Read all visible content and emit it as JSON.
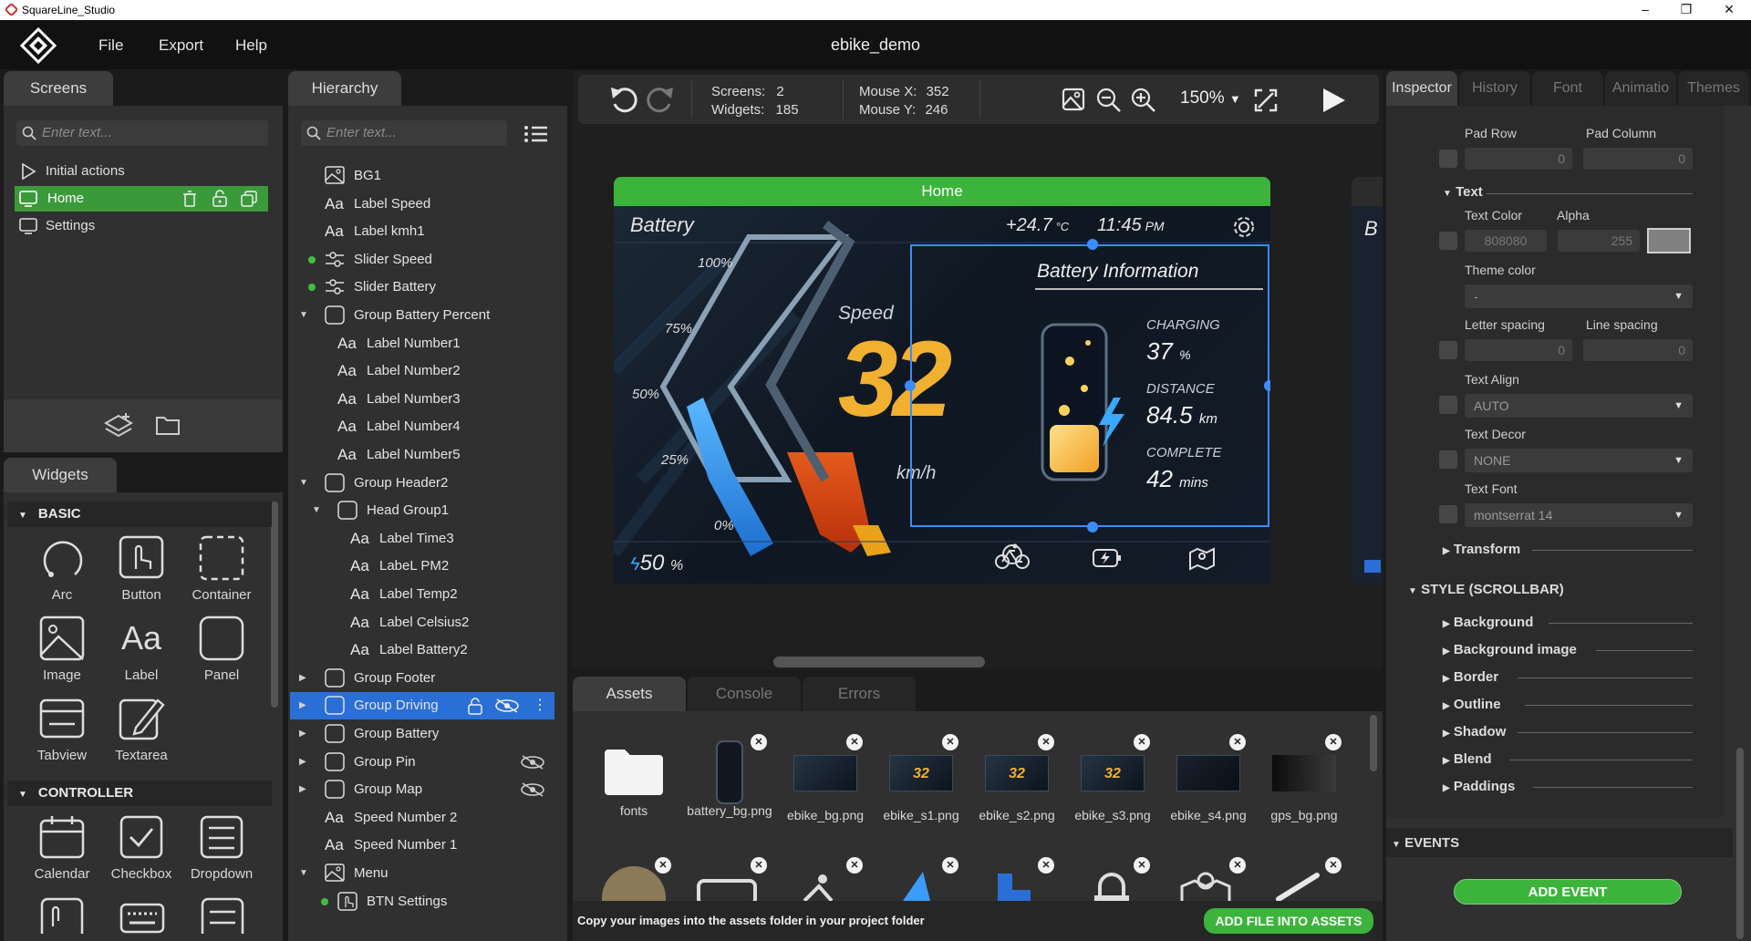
{
  "window": {
    "title": "SquareLine_Studio",
    "minimize": "–",
    "maximize": "❐",
    "close": "✕"
  },
  "menu": {
    "file": "File",
    "export": "Export",
    "help": "Help",
    "project_name": "ebike_demo"
  },
  "screens_panel": {
    "tab": "Screens",
    "search_placeholder": "Enter text...",
    "items": [
      {
        "label": "Initial actions"
      },
      {
        "label": "Home",
        "selected": true
      },
      {
        "label": "Settings"
      }
    ]
  },
  "widgets_panel": {
    "tab": "Widgets",
    "basic_section": "BASIC",
    "basic": [
      "Arc",
      "Button",
      "Container",
      "Image",
      "Label",
      "Panel",
      "Tabview",
      "Textarea"
    ],
    "controller_section": "CONTROLLER",
    "controller": [
      "Calendar",
      "Checkbox",
      "Dropdown"
    ]
  },
  "hierarchy_panel": {
    "tab": "Hierarchy",
    "search_placeholder": "Enter text...",
    "rows": [
      {
        "label": "BG1",
        "icon": "image-icon",
        "indent": 0
      },
      {
        "label": "Label Speed",
        "icon": "label-icon",
        "indent": 0
      },
      {
        "label": "Label kmh1",
        "icon": "label-icon",
        "indent": 0
      },
      {
        "label": "Slider Speed",
        "icon": "slider-icon",
        "indent": 0,
        "dot": true
      },
      {
        "label": "Slider Battery",
        "icon": "slider-icon",
        "indent": 0,
        "dot": true
      },
      {
        "label": "Group Battery Percent",
        "icon": "group-icon",
        "indent": 0,
        "expanded": true
      },
      {
        "label": "Label Number1",
        "icon": "label-icon",
        "indent": 1
      },
      {
        "label": "Label Number2",
        "icon": "label-icon",
        "indent": 1
      },
      {
        "label": "Label Number3",
        "icon": "label-icon",
        "indent": 1
      },
      {
        "label": "Label Number4",
        "icon": "label-icon",
        "indent": 1
      },
      {
        "label": "Label Number5",
        "icon": "label-icon",
        "indent": 1
      },
      {
        "label": "Group Header2",
        "icon": "group-icon",
        "indent": 0,
        "expanded": true
      },
      {
        "label": "Head Group1",
        "icon": "group-icon",
        "indent": 1,
        "expanded": true
      },
      {
        "label": "Label Time3",
        "icon": "label-icon",
        "indent": 2
      },
      {
        "label": "LabeL PM2",
        "icon": "label-icon",
        "indent": 2
      },
      {
        "label": "Label Temp2",
        "icon": "label-icon",
        "indent": 2
      },
      {
        "label": "Label Celsius2",
        "icon": "label-icon",
        "indent": 2
      },
      {
        "label": "Label Battery2",
        "icon": "label-icon",
        "indent": 2
      },
      {
        "label": "Group Footer",
        "icon": "group-icon",
        "indent": 0,
        "collapsed": true
      },
      {
        "label": "Group Driving",
        "icon": "group-icon",
        "indent": 0,
        "collapsed": true,
        "selected": true
      },
      {
        "label": "Group Battery",
        "icon": "group-icon",
        "indent": 0,
        "collapsed": true
      },
      {
        "label": "Group Pin",
        "icon": "group-icon",
        "indent": 0,
        "collapsed": true,
        "hidden": true
      },
      {
        "label": "Group Map",
        "icon": "group-icon",
        "indent": 0,
        "collapsed": true,
        "hidden": true
      },
      {
        "label": "Speed Number 2",
        "icon": "label-icon",
        "indent": 0
      },
      {
        "label": "Speed Number 1",
        "icon": "label-icon",
        "indent": 0
      },
      {
        "label": "Menu",
        "icon": "image-icon",
        "indent": 0,
        "expanded": true
      },
      {
        "label": "BTN Settings",
        "icon": "button-icon",
        "indent": 1,
        "dot": true
      }
    ]
  },
  "canvas_toolbar": {
    "screens_label": "Screens:",
    "screens_value": "2",
    "widgets_label": "Widgets:",
    "widgets_value": "185",
    "mousex_label": "Mouse X:",
    "mousex_value": "352",
    "mousey_label": "Mouse Y:",
    "mousey_value": "246",
    "zoom": "150%"
  },
  "screen_preview": {
    "screen_name": "Home",
    "battery_title": "Battery",
    "temp": "+24.7",
    "temp_unit": "°C",
    "time": "11:45",
    "ampm": "PM",
    "battery_info_title": "Battery Information",
    "speed_word": "Speed",
    "speed_value": "32",
    "speed_unit": "km/h",
    "ticks": [
      "100%",
      "75%",
      "50%",
      "25%",
      "0%"
    ],
    "charging_label": "CHARGING",
    "charging_value": "37",
    "charging_unit": "%",
    "distance_label": "DISTANCE",
    "distance_value": "84.5",
    "distance_unit": "km",
    "complete_label": "COMPLETE",
    "complete_value": "42",
    "complete_unit": "mins",
    "battery_bottom": "50",
    "battery_bottom_unit": "%",
    "next_screen_letter": "B"
  },
  "bottom_panel": {
    "tabs": [
      "Assets",
      "Console",
      "Errors"
    ],
    "assets": [
      {
        "name": "fonts"
      },
      {
        "name": "battery_bg.png"
      },
      {
        "name": "ebike_bg.png"
      },
      {
        "name": "ebike_s1.png"
      },
      {
        "name": "ebike_s2.png"
      },
      {
        "name": "ebike_s3.png"
      },
      {
        "name": "ebike_s4.png"
      },
      {
        "name": "gps_bg.png"
      }
    ],
    "hint": "Copy your images into the assets folder in your project folder",
    "add_button": "ADD FILE INTO ASSETS"
  },
  "inspector": {
    "tabs": [
      "Inspector",
      "History",
      "Font",
      "Animatio",
      "Themes"
    ],
    "pad_row_label": "Pad Row",
    "pad_row_value": "0",
    "pad_col_label": "Pad Column",
    "pad_col_value": "0",
    "text_section": "Text",
    "text_color_label": "Text Color",
    "alpha_label": "Alpha",
    "text_color_value": "808080",
    "alpha_value": "255",
    "theme_color_label": "Theme color",
    "theme_color_value": "-",
    "letter_spacing_label": "Letter spacing",
    "letter_spacing_value": "0",
    "line_spacing_label": "Line spacing",
    "line_spacing_value": "0",
    "text_align_label": "Text Align",
    "text_align_value": "AUTO",
    "text_decor_label": "Text Decor",
    "text_decor_value": "NONE",
    "text_font_label": "Text Font",
    "text_font_value": "montserrat 14",
    "transform": "Transform",
    "style_scrollbar": "STYLE (SCROLLBAR)",
    "style_props": [
      "Background",
      "Background image",
      "Border",
      "Outline",
      "Shadow",
      "Blend",
      "Paddings"
    ],
    "events": "EVENTS",
    "add_event": "ADD EVENT"
  },
  "colors": {
    "accent_green": "#3cb43c",
    "selected_blue": "#2a6fd6",
    "panel": "#303030"
  }
}
